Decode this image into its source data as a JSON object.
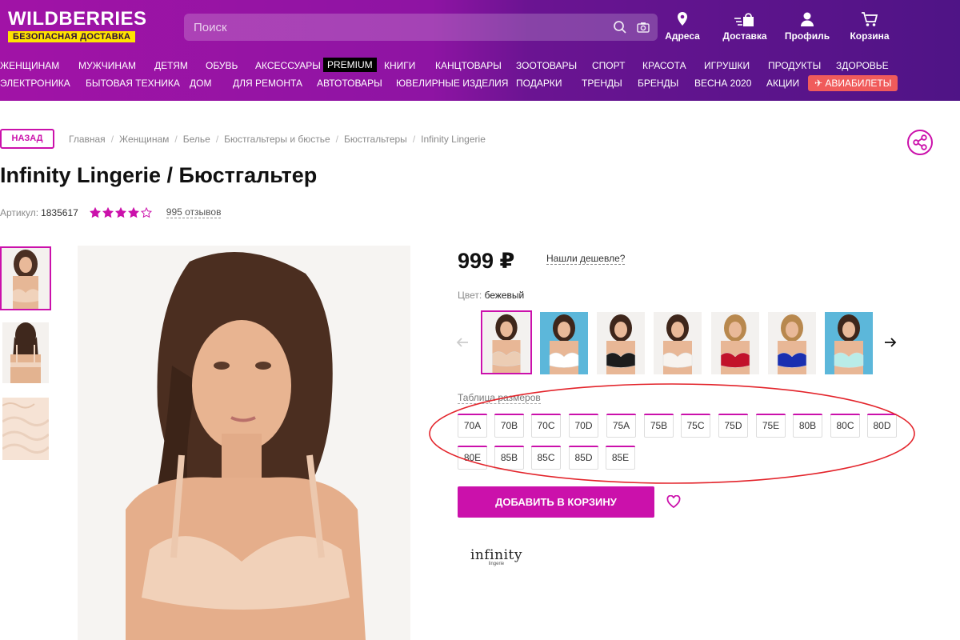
{
  "header": {
    "logo": "WILDBERRIES",
    "logo_tagline": "БЕЗОПАСНАЯ ДОСТАВКА",
    "search_placeholder": "Поиск",
    "actions": [
      {
        "label": "Адреса",
        "icon": "map-pin-icon"
      },
      {
        "label": "Доставка",
        "icon": "delivery-icon"
      },
      {
        "label": "Профиль",
        "icon": "user-icon"
      },
      {
        "label": "Корзина",
        "icon": "cart-icon"
      }
    ],
    "colors": {
      "brand": "#cb11ab",
      "tagline_bg": "#ffe300",
      "avia_bg": "#f05b5b"
    }
  },
  "nav": {
    "row1": [
      "ЖЕНЩИНАМ",
      "МУЖЧИНАМ",
      "ДЕТЯМ",
      "ОБУВЬ",
      "АКСЕССУАРЫ",
      "PREMIUM",
      "КНИГИ",
      "КАНЦТОВАРЫ",
      "ЗООТОВАРЫ",
      "СПОРТ",
      "КРАСОТА",
      "ИГРУШКИ",
      "ПРОДУКТЫ",
      "ЗДОРОВЬЕ"
    ],
    "row2": [
      "ЭЛЕКТРОНИКА",
      "БЫТОВАЯ ТЕХНИКА",
      "ДОМ",
      "ДЛЯ РЕМОНТА",
      "АВТОТОВАРЫ",
      "ЮВЕЛИРНЫЕ ИЗДЕЛИЯ",
      "ПОДАРКИ",
      "ТРЕНДЫ",
      "БРЕНДЫ",
      "ВЕСНА 2020",
      "АКЦИИ",
      "АВИАБИЛЕТЫ"
    ]
  },
  "back_label": "НАЗАД",
  "breadcrumb": [
    "Главная",
    "Женщинам",
    "Белье",
    "Бюстгальтеры и бюстье",
    "Бюстгальтеры",
    "Infinity Lingerie"
  ],
  "product": {
    "title": "Infinity Lingerie / Бюстгальтер",
    "article_label": "Артикул:",
    "article": "1835617",
    "rating": 4,
    "rating_max": 5,
    "reviews": "995 отзывов",
    "price": "999 ₽",
    "cheaper_link": "Нашли дешевле?",
    "color_label": "Цвет:",
    "color_value": "бежевый",
    "color_variants": [
      "#eccdb4",
      "#ffffff",
      "#1c1c1c",
      "#f7f3ef",
      "#c2122a",
      "#1a2fb0",
      "#b9ece8"
    ],
    "size_table_link": "Таблица размеров",
    "sizes_row1": [
      "70A",
      "70B",
      "70C",
      "70D",
      "75A",
      "75B",
      "75C",
      "75D",
      "75E",
      "80B",
      "80C",
      "80D"
    ],
    "sizes_row2": [
      "80E",
      "85B",
      "85C",
      "85D",
      "85E"
    ],
    "add_to_cart": "ДОБАВИТЬ В КОРЗИНУ",
    "brand_logo": "infinity",
    "brand_sub": "lingerie"
  }
}
